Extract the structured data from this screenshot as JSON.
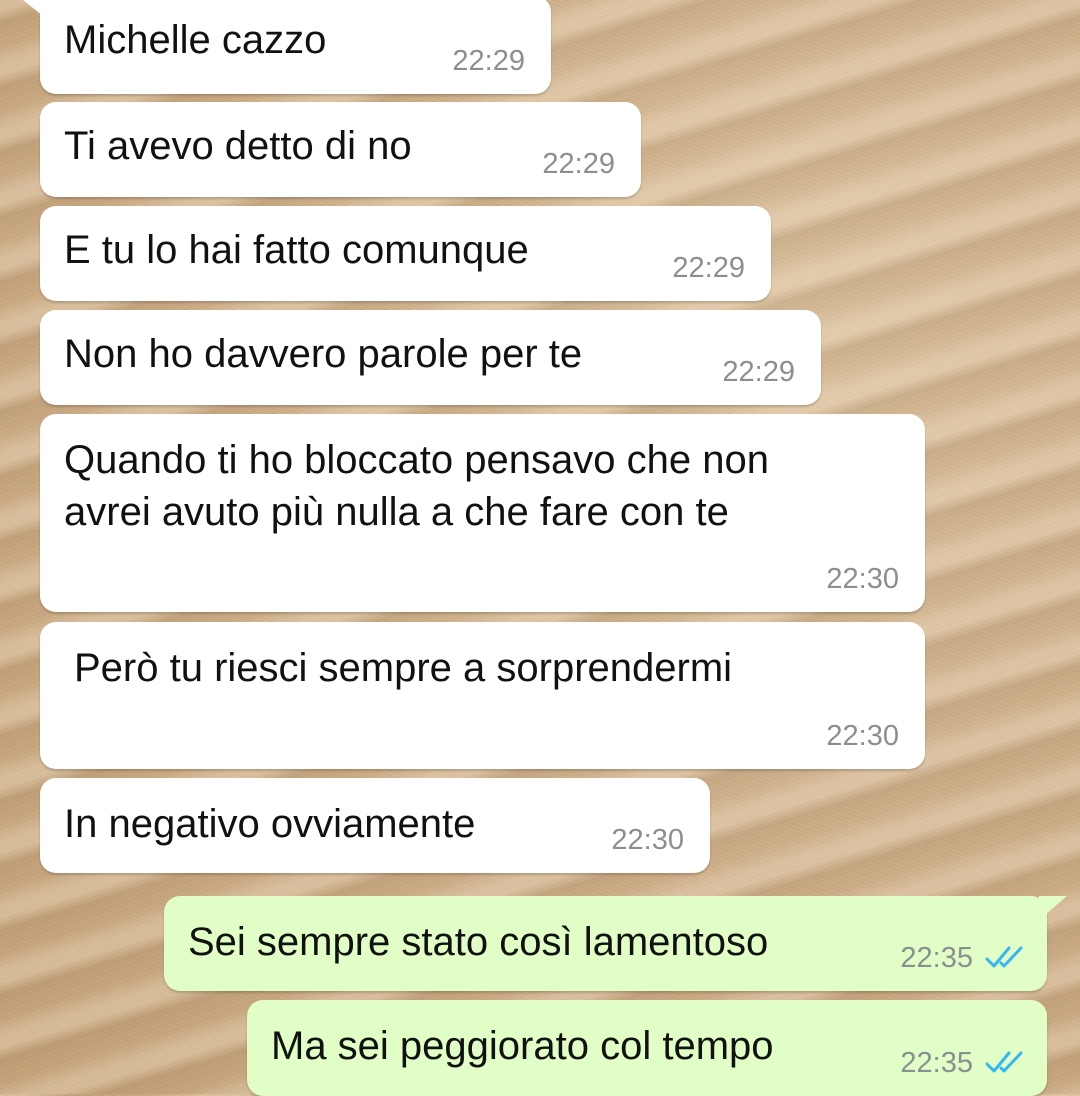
{
  "messages": [
    {
      "direction": "incoming",
      "text": "Michelle cazzo",
      "time": "22:29"
    },
    {
      "direction": "incoming",
      "text": "Ti avevo detto di no",
      "time": "22:29"
    },
    {
      "direction": "incoming",
      "text": "E tu lo hai fatto comunque",
      "time": "22:29"
    },
    {
      "direction": "incoming",
      "text": "Non ho davvero parole per te",
      "time": "22:29"
    },
    {
      "direction": "incoming",
      "text_line1": "Quando ti ho bloccato pensavo che non",
      "text_line2": "avrei avuto più nulla a che fare con te",
      "time": "22:30"
    },
    {
      "direction": "incoming",
      "text": "Però tu riesci sempre a sorprendermi",
      "time": "22:30"
    },
    {
      "direction": "incoming",
      "text": "In negativo ovviamente",
      "time": "22:30"
    },
    {
      "direction": "outgoing",
      "text": "Sei sempre stato così lamentoso",
      "time": "22:35",
      "status": "read",
      "status_icon": "double-check-icon"
    },
    {
      "direction": "outgoing",
      "text": "Ma sei peggiorato col tempo",
      "time": "22:35",
      "status": "read",
      "status_icon": "double-check-icon"
    }
  ],
  "colors": {
    "incoming_bubble": "#ffffff",
    "outgoing_bubble": "#e1fec6",
    "timestamp": "#8a8f92",
    "read_ticks": "#34b7f1",
    "wallpaper": "#d2b48f"
  }
}
